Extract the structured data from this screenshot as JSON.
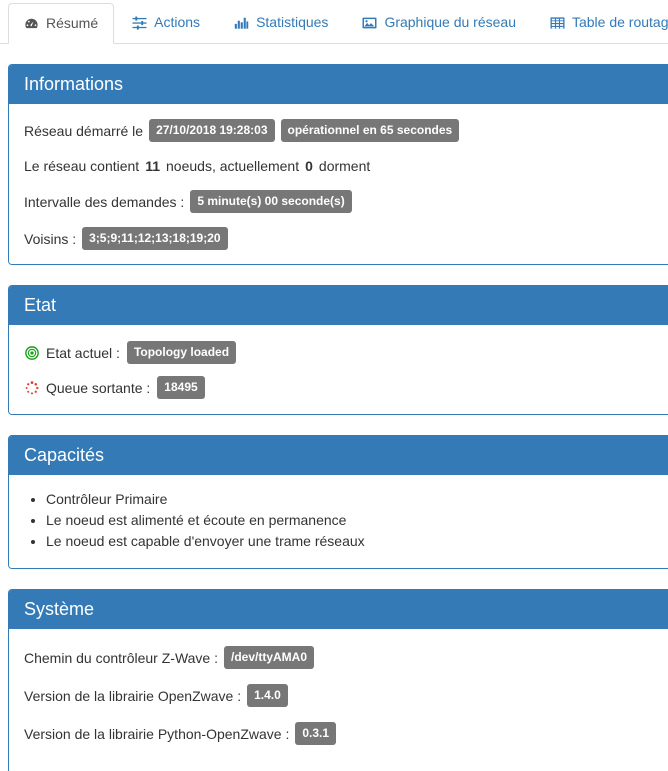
{
  "tabs": [
    {
      "label": "Résumé",
      "icon": "dashboard-icon",
      "active": true
    },
    {
      "label": "Actions",
      "icon": "sliders-icon",
      "active": false
    },
    {
      "label": "Statistiques",
      "icon": "bar-chart-icon",
      "active": false
    },
    {
      "label": "Graphique du réseau",
      "icon": "image-icon",
      "active": false
    },
    {
      "label": "Table de routage",
      "icon": "table-icon",
      "active": false
    }
  ],
  "colors": {
    "panel_blue": "#337ab7",
    "badge_gray": "#777777",
    "link_blue": "#337ab7",
    "status_green": "#15a015",
    "spinner_red": "#e8382f"
  },
  "informations": {
    "title": "Informations",
    "started_prefix": "Réseau démarré le",
    "started_at": "27/10/2018 19:28:03",
    "operational": "opérationnel en 65 secondes",
    "nodes_prefix": "Le réseau contient",
    "nodes_count": "11",
    "nodes_mid": "noeuds, actuellement",
    "sleeping_count": "0",
    "nodes_suffix": "dorment",
    "interval_label": "Intervalle des demandes :",
    "interval_value": "5 minute(s) 00 seconde(s)",
    "neighbors_label": "Voisins :",
    "neighbors_value": "3;5;9;11;12;13;18;19;20"
  },
  "etat": {
    "title": "Etat",
    "current_label": "Etat actuel :",
    "current_value": "Topology loaded",
    "queue_label": "Queue sortante :",
    "queue_value": "18495"
  },
  "capacites": {
    "title": "Capacités",
    "items": [
      "Contrôleur Primaire",
      "Le noeud est alimenté et écoute en permanence",
      "Le noeud est capable d'envoyer une trame réseaux"
    ]
  },
  "systeme": {
    "title": "Système",
    "controller_path_label": "Chemin du contrôleur Z-Wave :",
    "controller_path_value": "/dev/ttyAMA0",
    "openzwave_label": "Version de la librairie OpenZwave :",
    "openzwave_value": "1.4.0",
    "python_openzwave_label": "Version de la librairie Python-OpenZwave :",
    "python_openzwave_value": "0.3.1"
  }
}
